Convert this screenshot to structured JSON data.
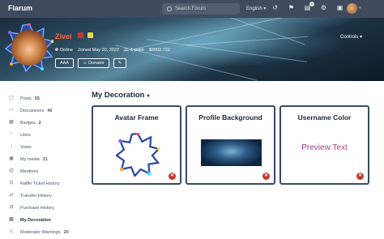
{
  "header": {
    "brand": "Flarum",
    "search_placeholder": "Search Forum",
    "language": "English",
    "notification_badge": "1"
  },
  "profile": {
    "username": "Zivei",
    "status": "Online",
    "joined": "Joined May 20, 2022",
    "points": "-1 point",
    "money": "$9002.722",
    "buttons": [
      "AAA",
      "Donator"
    ],
    "controls_label": "Controls"
  },
  "sidebar": {
    "items": [
      {
        "label": "Posts",
        "count": "55",
        "icon": "posts-icon"
      },
      {
        "label": "Discussions",
        "count": "40",
        "icon": "discussions-icon"
      },
      {
        "label": "Badges",
        "count": "2",
        "icon": "badges-icon"
      },
      {
        "label": "Likes",
        "count": "",
        "icon": "likes-icon"
      },
      {
        "label": "Votes",
        "count": "",
        "icon": "votes-icon"
      },
      {
        "label": "My media",
        "count": "21",
        "icon": "media-icon"
      },
      {
        "label": "Mentions",
        "count": "",
        "icon": "mentions-icon"
      },
      {
        "label": "Raffle Ticket History",
        "count": "",
        "icon": "raffle-icon"
      },
      {
        "label": "Transfer History",
        "count": "",
        "icon": "transfer-icon"
      },
      {
        "label": "Purchase History",
        "count": "",
        "icon": "purchase-icon"
      },
      {
        "label": "My Decoration",
        "count": "",
        "icon": "decoration-icon"
      },
      {
        "label": "Moderator Warnings",
        "count": "20",
        "icon": "warning-icon"
      }
    ],
    "active_index": 10
  },
  "main": {
    "title": "My Decoration",
    "cards": [
      {
        "title": "Avatar Frame"
      },
      {
        "title": "Profile Background"
      },
      {
        "title": "Username Color",
        "preview": "Preview Text"
      }
    ]
  },
  "colors": {
    "header_bg": "#3f4a5e",
    "card_border": "#3b4a63",
    "username": "#ff6a3d",
    "delete": "#c0392b"
  }
}
